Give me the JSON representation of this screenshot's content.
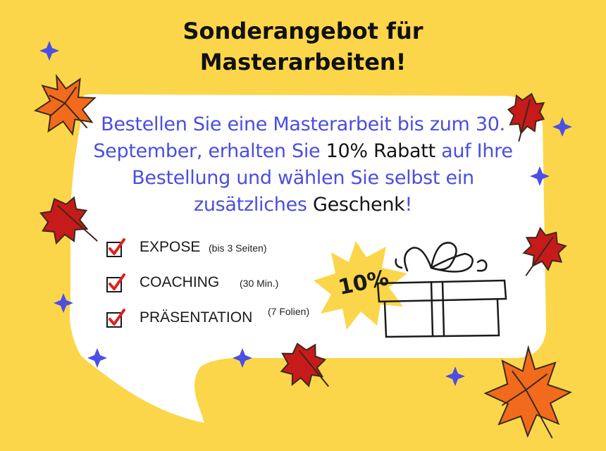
{
  "title": {
    "line1": "Sonderangebot für",
    "line2": "Masterarbeiten!"
  },
  "promo": {
    "part1": "Bestellen Sie eine Masterarbeit bis zum 30. September, erhalten Sie ",
    "highlight1": "10% Rabatt",
    "part2": " auf Ihre Bestellung und wählen Sie selbst ein zusätzliches ",
    "highlight2": "Geschenk",
    "part3": "!"
  },
  "options": [
    {
      "label": "EXPOSE",
      "note": "(bis 3 Seiten)"
    },
    {
      "label": "COACHING",
      "note": "(30 Min.)"
    },
    {
      "label": "PRÄSENTATION",
      "note": "(7 Folien)"
    }
  ],
  "badge": {
    "text": "10%"
  },
  "colors": {
    "background": "#fcd64a",
    "card": "#ffffff",
    "promo_text": "#4a4ee0",
    "check_red": "#e02020",
    "leaf_orange": "#f26a1b",
    "leaf_red": "#c71a1a",
    "star_blue": "#4b4fe6",
    "badge_yellow": "#fcd64a"
  },
  "icons": {
    "checkbox": "checkbox-checked-icon",
    "gift": "gift-box-icon",
    "leaf": "autumn-leaf-icon",
    "star": "sparkle-star-icon"
  }
}
